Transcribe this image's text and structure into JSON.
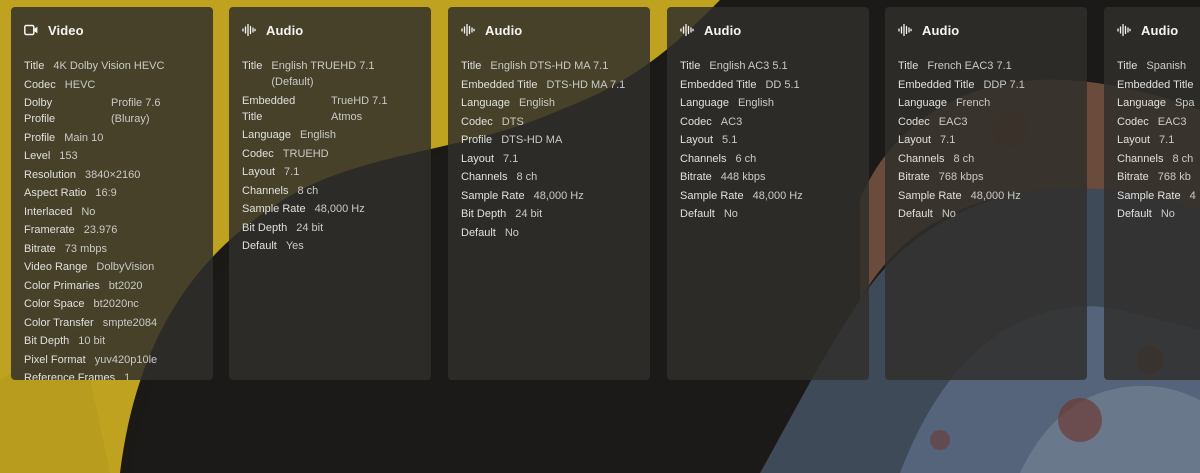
{
  "colors": {
    "poster_yellow": "#bfa21f",
    "poster_dark": "#1b1916",
    "card_bg": "#302e2b",
    "text_label": "#e0e0dd",
    "text_value": "#cacac6"
  },
  "cards": [
    {
      "icon": "video-icon",
      "title": "Video",
      "rows": [
        {
          "k": "Title",
          "v": "4K Dolby Vision HEVC"
        },
        {
          "k": "Codec",
          "v": "HEVC"
        },
        {
          "k": "Dolby Profile",
          "v": "Profile 7.6 (Bluray)"
        },
        {
          "k": "Profile",
          "v": "Main 10"
        },
        {
          "k": "Level",
          "v": "153"
        },
        {
          "k": "Resolution",
          "v": "3840×2160"
        },
        {
          "k": "Aspect Ratio",
          "v": "16:9"
        },
        {
          "k": "Interlaced",
          "v": "No"
        },
        {
          "k": "Framerate",
          "v": "23.976"
        },
        {
          "k": "Bitrate",
          "v": "73 mbps"
        },
        {
          "k": "Video Range",
          "v": "DolbyVision"
        },
        {
          "k": "Color Primaries",
          "v": "bt2020"
        },
        {
          "k": "Color Space",
          "v": "bt2020nc"
        },
        {
          "k": "Color Transfer",
          "v": "smpte2084"
        },
        {
          "k": "Bit Depth",
          "v": "10 bit"
        },
        {
          "k": "Pixel Format",
          "v": "yuv420p10le"
        },
        {
          "k": "Reference Frames",
          "v": "1"
        }
      ]
    },
    {
      "icon": "audio-waveform-icon",
      "title": "Audio",
      "rows": [
        {
          "k": "Title",
          "v": "English TRUEHD 7.1 (Default)"
        },
        {
          "k": "Embedded Title",
          "v": "TrueHD 7.1 Atmos"
        },
        {
          "k": "Language",
          "v": "English"
        },
        {
          "k": "Codec",
          "v": "TRUEHD"
        },
        {
          "k": "Layout",
          "v": "7.1"
        },
        {
          "k": "Channels",
          "v": "8 ch"
        },
        {
          "k": "Sample Rate",
          "v": "48,000 Hz"
        },
        {
          "k": "Bit Depth",
          "v": "24 bit"
        },
        {
          "k": "Default",
          "v": "Yes"
        }
      ]
    },
    {
      "icon": "audio-waveform-icon",
      "title": "Audio",
      "rows": [
        {
          "k": "Title",
          "v": "English DTS-HD MA 7.1"
        },
        {
          "k": "Embedded Title",
          "v": "DTS-HD MA 7.1"
        },
        {
          "k": "Language",
          "v": "English"
        },
        {
          "k": "Codec",
          "v": "DTS"
        },
        {
          "k": "Profile",
          "v": "DTS-HD MA"
        },
        {
          "k": "Layout",
          "v": "7.1"
        },
        {
          "k": "Channels",
          "v": "8 ch"
        },
        {
          "k": "Sample Rate",
          "v": "48,000 Hz"
        },
        {
          "k": "Bit Depth",
          "v": "24 bit"
        },
        {
          "k": "Default",
          "v": "No"
        }
      ]
    },
    {
      "icon": "audio-waveform-icon",
      "title": "Audio",
      "rows": [
        {
          "k": "Title",
          "v": "English AC3 5.1"
        },
        {
          "k": "Embedded Title",
          "v": "DD 5.1"
        },
        {
          "k": "Language",
          "v": "English"
        },
        {
          "k": "Codec",
          "v": "AC3"
        },
        {
          "k": "Layout",
          "v": "5.1"
        },
        {
          "k": "Channels",
          "v": "6 ch"
        },
        {
          "k": "Bitrate",
          "v": "448 kbps"
        },
        {
          "k": "Sample Rate",
          "v": "48,000 Hz"
        },
        {
          "k": "Default",
          "v": "No"
        }
      ]
    },
    {
      "icon": "audio-waveform-icon",
      "title": "Audio",
      "rows": [
        {
          "k": "Title",
          "v": "French EAC3 7.1"
        },
        {
          "k": "Embedded Title",
          "v": "DDP 7.1"
        },
        {
          "k": "Language",
          "v": "French"
        },
        {
          "k": "Codec",
          "v": "EAC3"
        },
        {
          "k": "Layout",
          "v": "7.1"
        },
        {
          "k": "Channels",
          "v": "8 ch"
        },
        {
          "k": "Bitrate",
          "v": "768 kbps"
        },
        {
          "k": "Sample Rate",
          "v": "48,000 Hz"
        },
        {
          "k": "Default",
          "v": "No"
        }
      ]
    },
    {
      "icon": "audio-waveform-icon",
      "title": "Audio",
      "rows": [
        {
          "k": "Title",
          "v": "Spanish"
        },
        {
          "k": "Embedded Title",
          "v": ""
        },
        {
          "k": "Language",
          "v": "Spa"
        },
        {
          "k": "Codec",
          "v": "EAC3"
        },
        {
          "k": "Layout",
          "v": "7.1"
        },
        {
          "k": "Channels",
          "v": "8 ch"
        },
        {
          "k": "Bitrate",
          "v": "768 kb"
        },
        {
          "k": "Sample Rate",
          "v": "4"
        },
        {
          "k": "Default",
          "v": "No"
        }
      ]
    }
  ]
}
